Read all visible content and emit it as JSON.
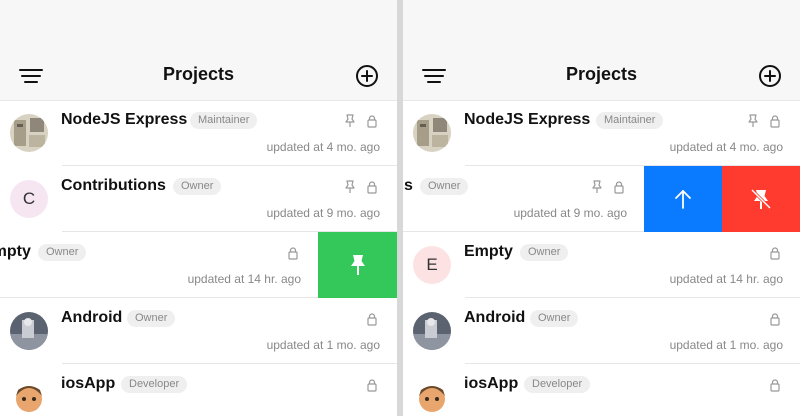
{
  "colors": {
    "pin_action": "#34c759",
    "move_up_action": "#0a7aff",
    "unpin_action": "#ff3b30"
  },
  "screens": [
    {
      "nav": {
        "title": "Projects",
        "menu_icon": "hamburger-icon",
        "add_icon": "plus-circle-icon"
      },
      "rows": [
        {
          "name": "NodeJS Express",
          "role": "Maintainer",
          "updated": "updated at 4 mo. ago",
          "pinned": true,
          "locked": true
        },
        {
          "avatar_letter": "C",
          "name": "Contributions",
          "role": "Owner",
          "updated": "updated at 9 mo. ago",
          "pinned": true,
          "locked": true
        },
        {
          "name": "Empty",
          "name_visible": "mpty",
          "role": "Owner",
          "updated": "updated at 14 hr. ago",
          "locked": true,
          "swipe_action": "pin"
        },
        {
          "name": "Android",
          "role": "Owner",
          "updated": "updated at 1 mo. ago",
          "locked": true
        },
        {
          "name": "iosApp",
          "role": "Developer",
          "locked": true
        }
      ]
    },
    {
      "nav": {
        "title": "Projects",
        "menu_icon": "hamburger-icon",
        "add_icon": "plus-circle-icon"
      },
      "rows": [
        {
          "name": "NodeJS Express",
          "role": "Maintainer",
          "updated": "updated at 4 mo. ago",
          "pinned": true,
          "locked": true
        },
        {
          "name": "Contributions",
          "name_visible": "s",
          "role": "Owner",
          "updated": "updated at 9 mo. ago",
          "pinned": true,
          "locked": true,
          "swipe_actions": [
            "move-up",
            "unpin"
          ]
        },
        {
          "avatar_letter": "E",
          "name": "Empty",
          "role": "Owner",
          "updated": "updated at 14 hr. ago",
          "locked": true
        },
        {
          "name": "Android",
          "role": "Owner",
          "updated": "updated at 1 mo. ago",
          "locked": true
        },
        {
          "name": "iosApp",
          "role": "Developer",
          "locked": true
        }
      ]
    }
  ]
}
